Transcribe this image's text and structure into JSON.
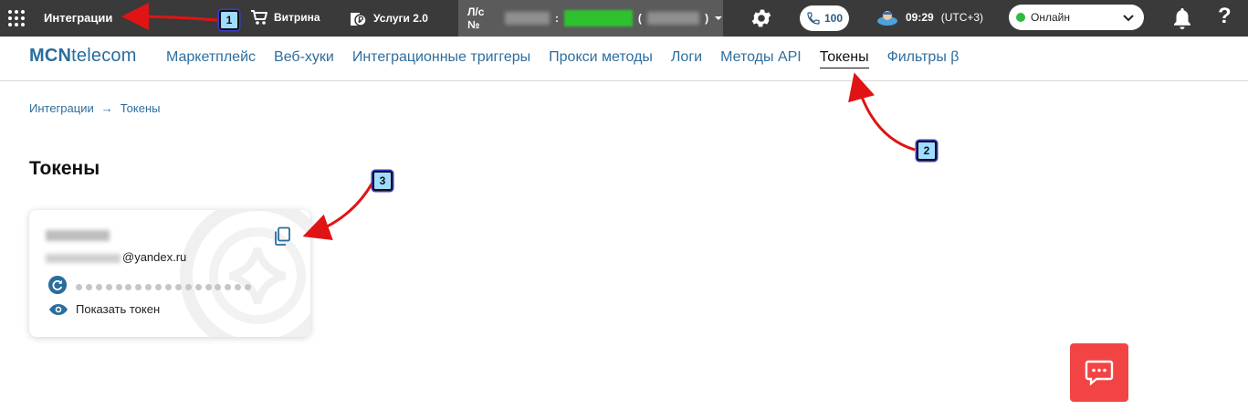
{
  "topbar": {
    "section_title": "Интеграции",
    "showcase_label": "Витрина",
    "services_label": "Услуги 2.0",
    "account_label": "Л/с №",
    "account_colon": ":",
    "account_paren_open": "(",
    "account_paren_close": ")",
    "calls_count": "100",
    "time": "09:29",
    "timezone": "(UTC+3)",
    "status": "Онлайн",
    "help_symbol": "?"
  },
  "logo": {
    "brand_bold": "MCN",
    "brand_rest": "telecom"
  },
  "tabs": [
    {
      "label": "Маркетплейс"
    },
    {
      "label": "Веб-хуки"
    },
    {
      "label": "Интеграционные триггеры"
    },
    {
      "label": "Прокси методы"
    },
    {
      "label": "Логи"
    },
    {
      "label": "Методы API"
    },
    {
      "label": "Токены",
      "active": true
    },
    {
      "label": "Фильтры β"
    }
  ],
  "breadcrumb": {
    "root": "Интеграции",
    "separator": "→",
    "current": "Токены"
  },
  "page_title": "Токены",
  "token_card": {
    "email_domain": "@yandex.ru",
    "show_token_label": "Показать токен",
    "masked_dot_count": 18
  },
  "annotations": {
    "badge_1": "1",
    "badge_2": "2",
    "badge_3": "3"
  },
  "colors": {
    "topbar_bg": "#3a3a3a",
    "link_blue": "#2e6e9e",
    "online_green": "#2fbb3d",
    "chat_red": "#f24444",
    "arrow_red": "#e01414"
  }
}
